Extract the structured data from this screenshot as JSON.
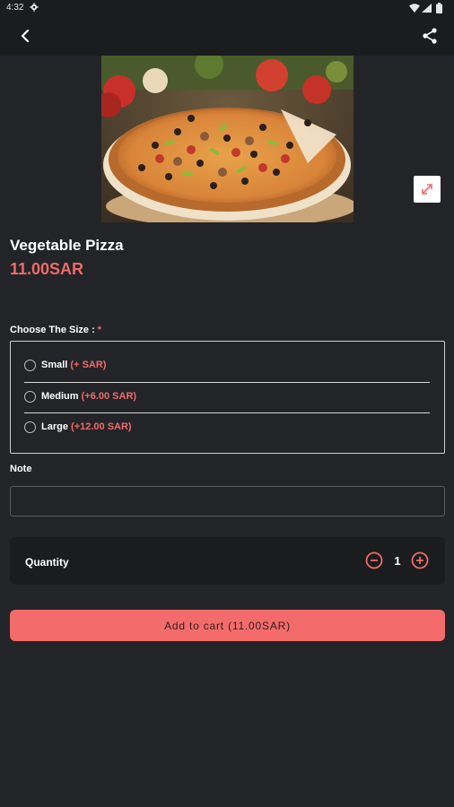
{
  "status_bar": {
    "time": "4:32"
  },
  "app_bar": {
    "back_icon": "back-arrow-icon",
    "share_icon": "share-icon"
  },
  "product": {
    "image_alt": "pizza-photo",
    "title": "Vegetable Pizza",
    "price": "11.00SAR",
    "expand_icon": "expand-icon"
  },
  "size": {
    "label": "Choose The Size : ",
    "required_mark": "*",
    "options": [
      {
        "name": "Small",
        "extra": "(+ SAR)"
      },
      {
        "name": "Medium",
        "extra": "(+6.00 SAR)"
      },
      {
        "name": "Large",
        "extra": "(+12.00 SAR)"
      }
    ]
  },
  "note": {
    "label": "Note",
    "value": "",
    "placeholder": ""
  },
  "quantity": {
    "label": "Quantity",
    "value": "1"
  },
  "cart": {
    "button_label": "Add to cart (11.00SAR)"
  },
  "colors": {
    "background": "#232427",
    "bar": "#1b1c1e",
    "accent": "#f06a6a",
    "button": "#f46b6b"
  }
}
